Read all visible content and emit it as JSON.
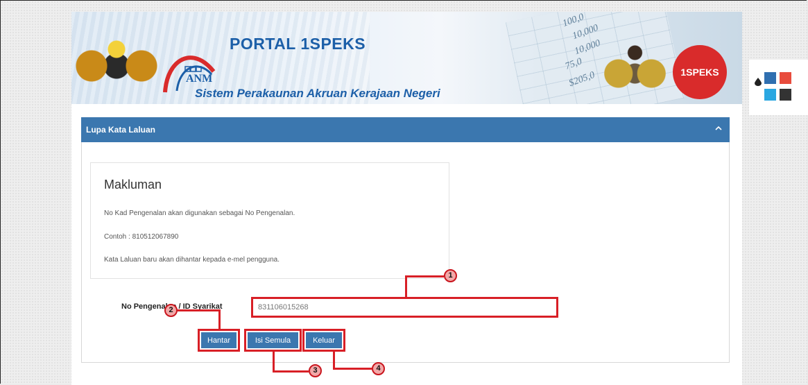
{
  "header": {
    "portal_title": "PORTAL 1SPEKS",
    "anm_label": "ANM",
    "system_name": "Sistem Perakaunan Akruan Kerajaan Negeri",
    "logo_text": "1SPEKS",
    "ledger_numbers": [
      "100,0",
      "10,000",
      "10,000",
      "75,0",
      "$205,0"
    ]
  },
  "theme_switcher": {
    "icon": "droplet-icon",
    "swatches": [
      "#2f6fb0",
      "#e84c3d",
      "#2aa7e1",
      "#333333"
    ]
  },
  "panel": {
    "title": "Lupa Kata Laluan",
    "collapse_icon": "chevron-up-icon"
  },
  "info": {
    "title": "Makluman",
    "lines": [
      "No Kad Pengenalan akan digunakan sebagai No Pengenalan.",
      "Contoh : 810512067890",
      "Kata Laluan baru akan dihantar kepada e-mel pengguna."
    ]
  },
  "form": {
    "field_label": "No Pengenalan / ID Syarikat",
    "field_value": "831106015268"
  },
  "buttons": {
    "submit": "Hantar",
    "reset": "Isi Semula",
    "exit": "Keluar"
  },
  "callouts": [
    "1",
    "2",
    "3",
    "4"
  ],
  "colors": {
    "primary": "#3b77af",
    "highlight": "#d81f26",
    "callout_fill": "#f2a8a8"
  }
}
